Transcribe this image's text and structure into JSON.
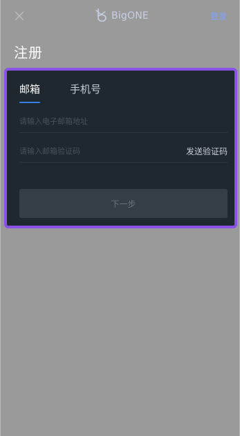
{
  "header": {
    "brand_name": "BigONE",
    "login_label": "登录"
  },
  "page": {
    "title": "注册"
  },
  "tabs": [
    {
      "label": "邮箱",
      "active": true
    },
    {
      "label": "手机号",
      "active": false
    }
  ],
  "form": {
    "email_placeholder": "请输入电子邮箱地址",
    "email_value": "",
    "code_placeholder": "请输入邮箱验证码",
    "code_value": "",
    "send_code_label": "发送验证码",
    "next_label": "下一步"
  },
  "colors": {
    "background": "#9a9a9a",
    "card": "#1f272f",
    "highlight_border": "#8a52e6",
    "accent": "#3a7fe6",
    "login_link": "#7fa4ff"
  },
  "icons": {
    "close": "close-icon",
    "logo": "bigone-logo-icon"
  }
}
